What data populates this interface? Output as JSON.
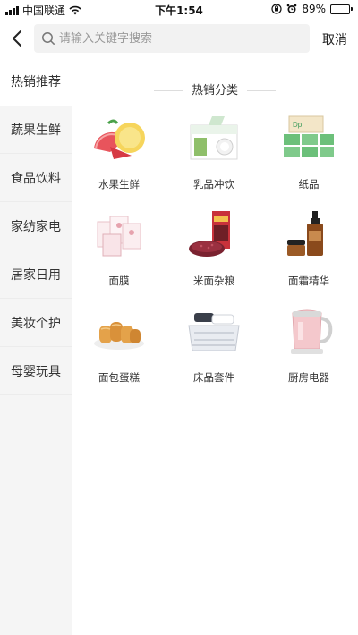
{
  "status_bar": {
    "carrier": "中国联通",
    "time": "下午1:54",
    "battery_percent": "89%",
    "battery_level": 0.89
  },
  "search": {
    "placeholder": "请输入关键字搜索",
    "cancel_label": "取消"
  },
  "sidebar": {
    "items": [
      {
        "label": "热销推荐",
        "active": true
      },
      {
        "label": "蔬果生鲜",
        "active": false
      },
      {
        "label": "食品饮料",
        "active": false
      },
      {
        "label": "家纺家电",
        "active": false
      },
      {
        "label": "居家日用",
        "active": false
      },
      {
        "label": "美妆个护",
        "active": false
      },
      {
        "label": "母婴玩具",
        "active": false
      }
    ]
  },
  "main": {
    "section_title": "热销分类",
    "categories": [
      {
        "label": "水果生鲜",
        "icon": "fruit-icon"
      },
      {
        "label": "乳品冲饮",
        "icon": "milk-icon"
      },
      {
        "label": "纸品",
        "icon": "tissue-icon"
      },
      {
        "label": "面膜",
        "icon": "face-mask-icon"
      },
      {
        "label": "米面杂粮",
        "icon": "grain-icon"
      },
      {
        "label": "面霜精华",
        "icon": "serum-icon"
      },
      {
        "label": "面包蛋糕",
        "icon": "bread-icon"
      },
      {
        "label": "床品套件",
        "icon": "bedding-icon"
      },
      {
        "label": "厨房电器",
        "icon": "kettle-icon"
      }
    ]
  }
}
